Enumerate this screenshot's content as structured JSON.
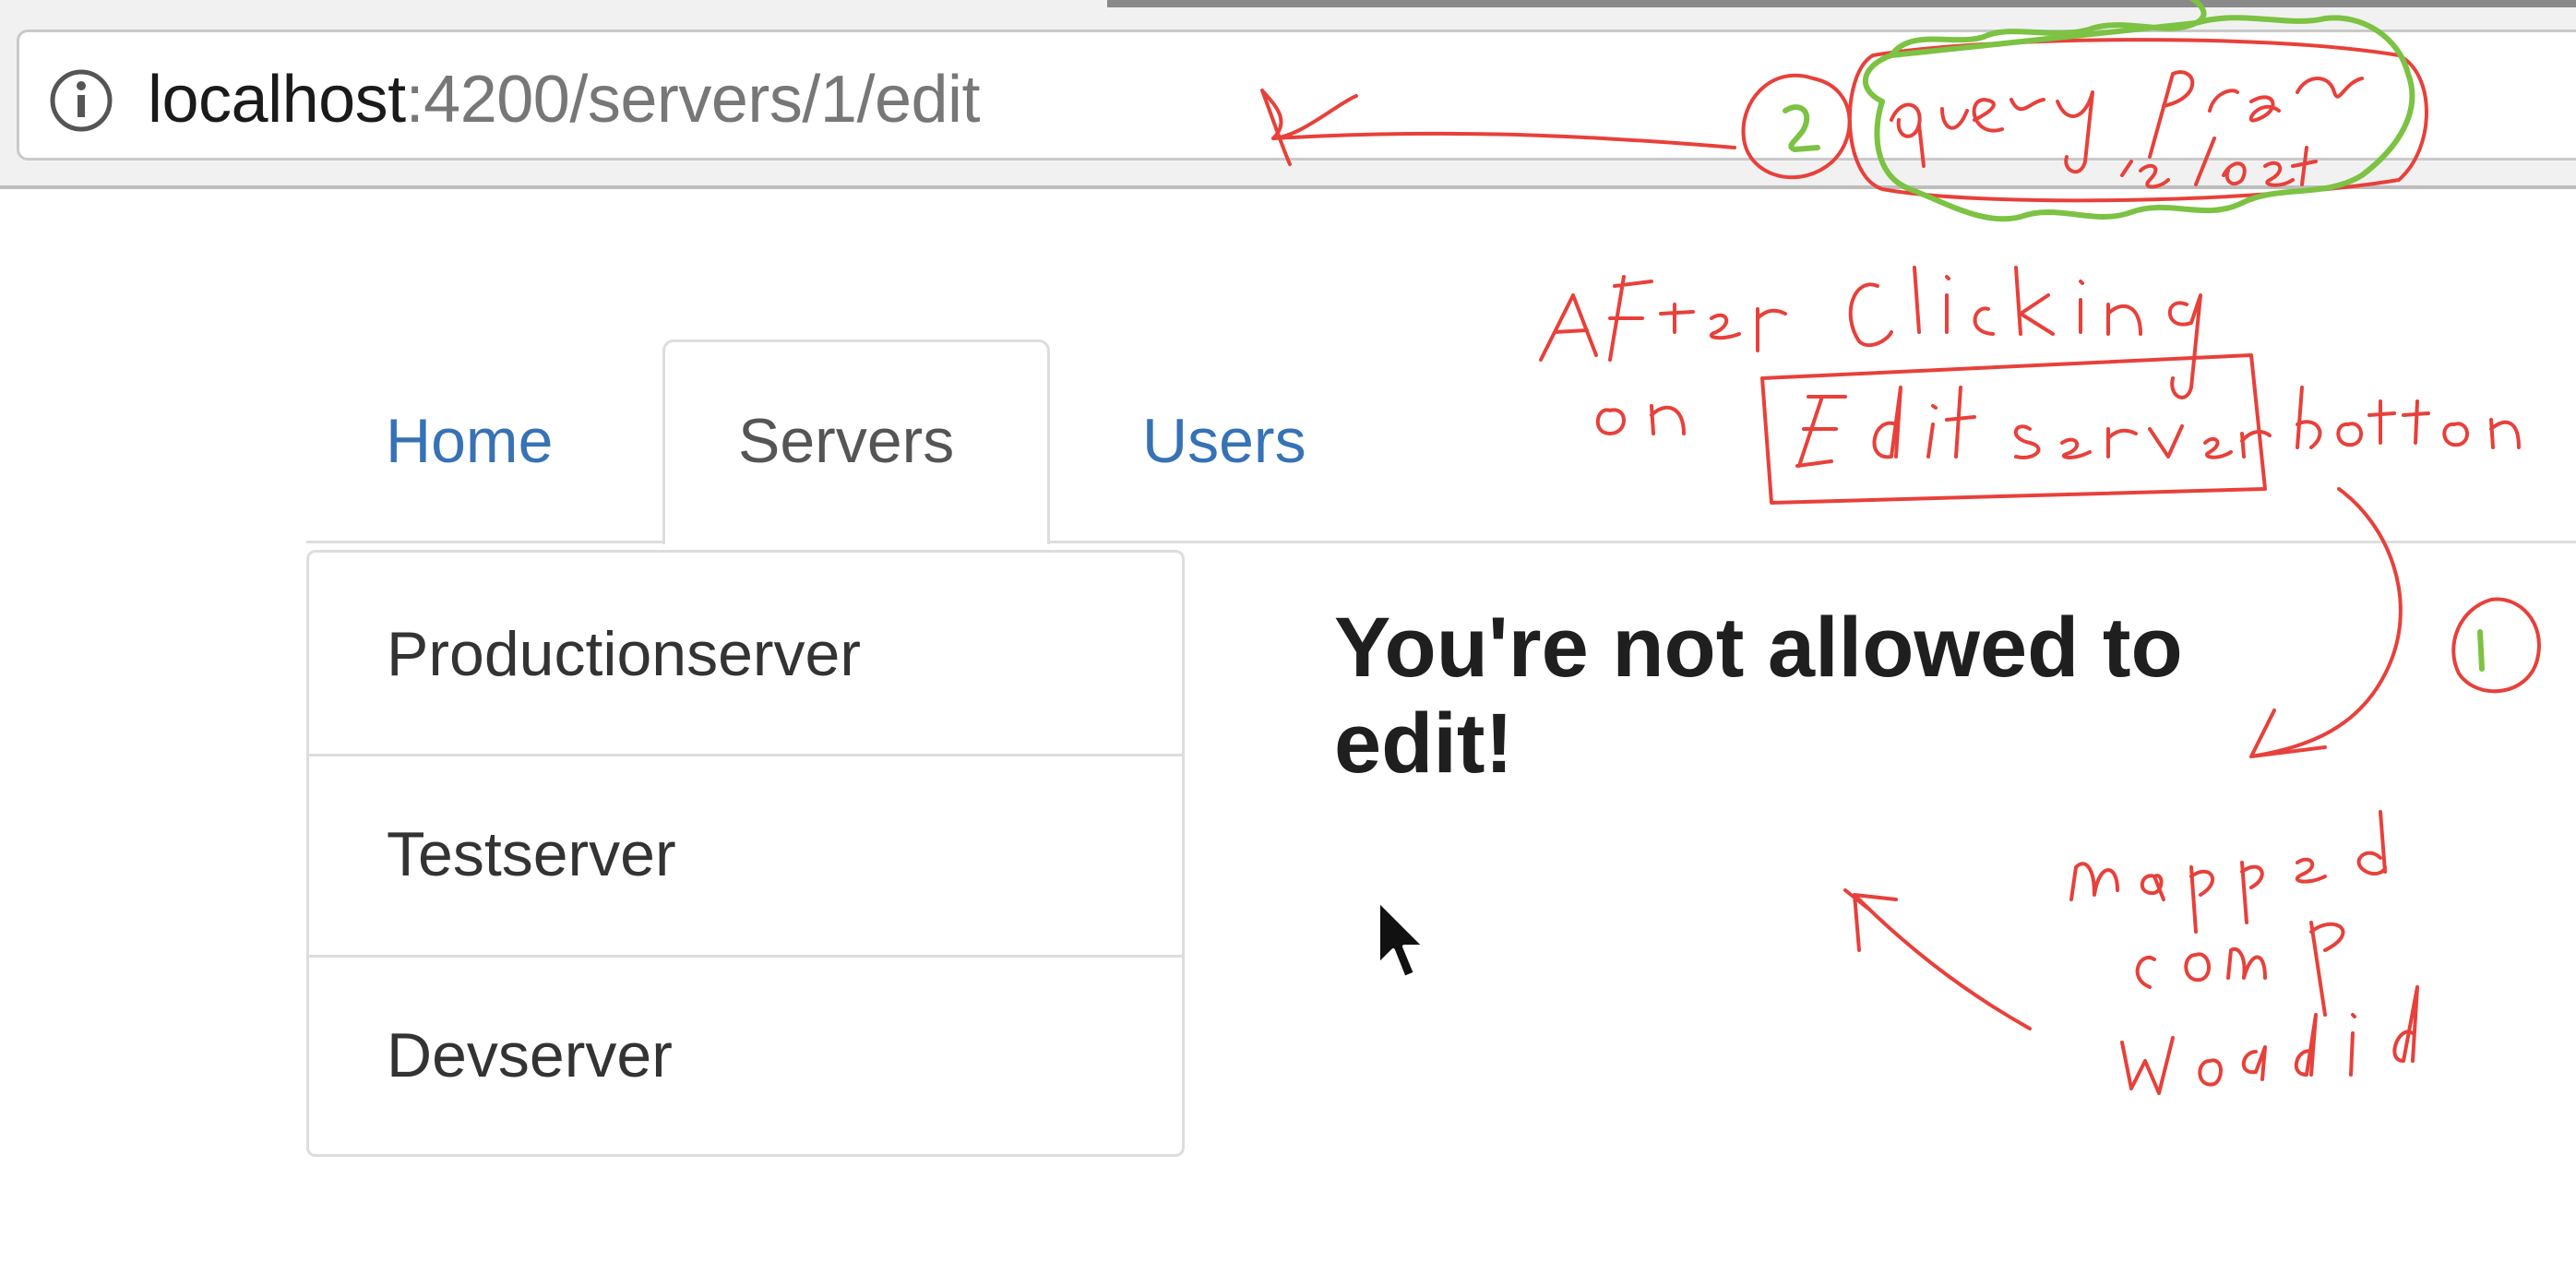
{
  "browser": {
    "url_host": "localhost",
    "url_path": ":4200/servers/1/edit"
  },
  "nav": {
    "tabs": [
      {
        "label": "Home",
        "active": false
      },
      {
        "label": "Servers",
        "active": true
      },
      {
        "label": "Users",
        "active": false
      }
    ]
  },
  "servers": {
    "items": [
      "Productionserver",
      "Testserver",
      "Devserver"
    ]
  },
  "main": {
    "message": "You're not allowed to edit!"
  },
  "annotations": {
    "color_red": "#e8403a",
    "color_green": "#7cc243"
  }
}
